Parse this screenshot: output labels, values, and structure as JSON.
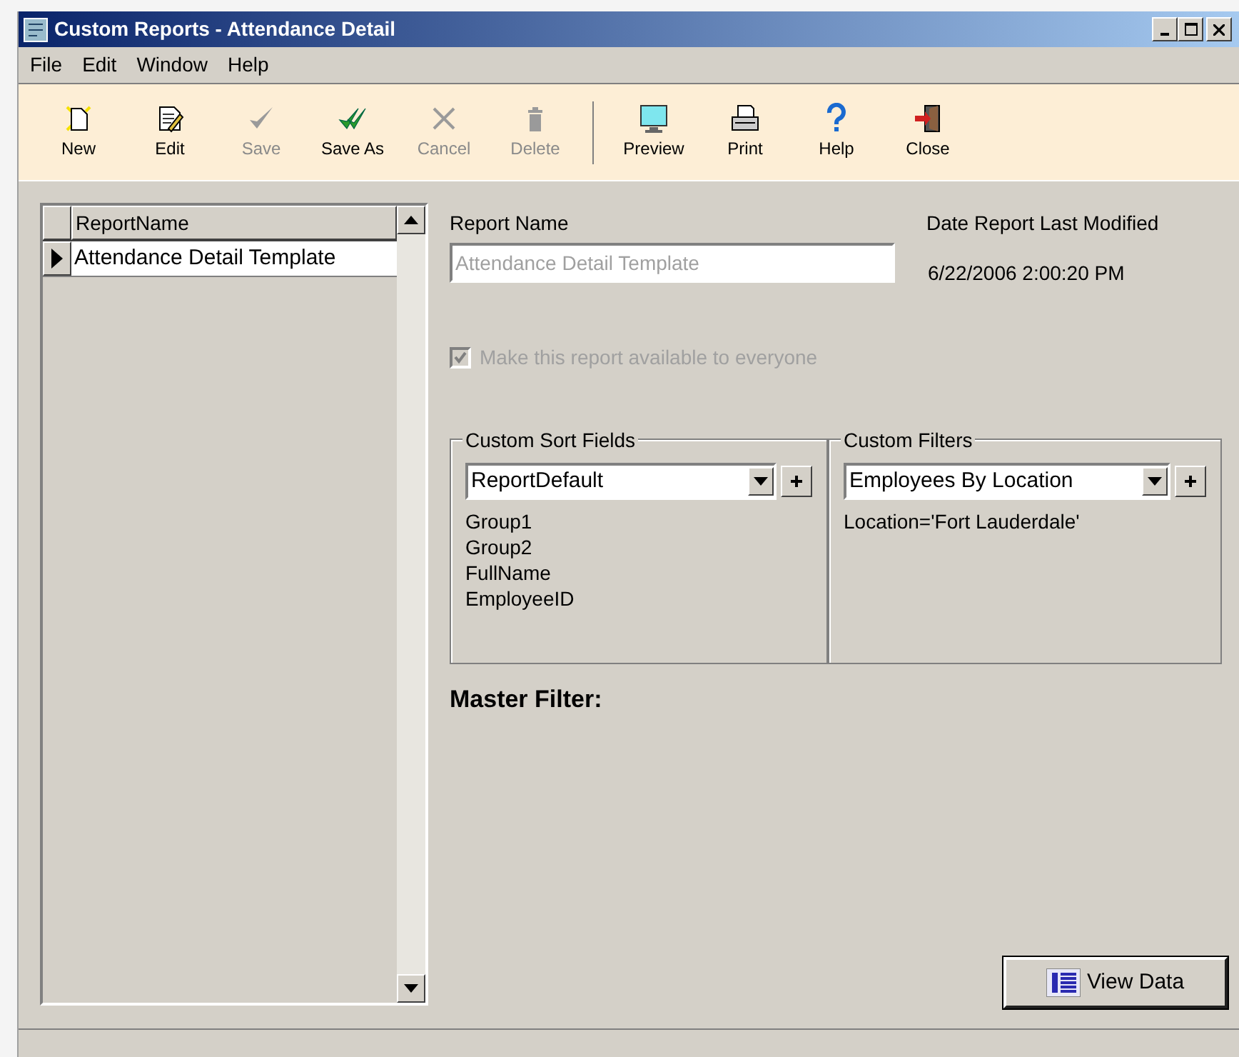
{
  "window": {
    "title": "Custom Reports - Attendance Detail"
  },
  "menu": [
    "File",
    "Edit",
    "Window",
    "Help"
  ],
  "toolbar": {
    "groups": [
      [
        {
          "label": "New",
          "disabled": false
        },
        {
          "label": "Edit",
          "disabled": false
        },
        {
          "label": "Save",
          "disabled": true
        },
        {
          "label": "Save As",
          "disabled": false
        },
        {
          "label": "Cancel",
          "disabled": true
        },
        {
          "label": "Delete",
          "disabled": true
        }
      ],
      [
        {
          "label": "Preview",
          "disabled": false
        },
        {
          "label": "Print",
          "disabled": false
        },
        {
          "label": "Help",
          "disabled": false
        },
        {
          "label": "Close",
          "disabled": false
        }
      ]
    ]
  },
  "report_list": {
    "columns": [
      "ReportName"
    ],
    "rows": [
      {
        "cells": [
          "Attendance Detail Template"
        ],
        "selected": true
      }
    ]
  },
  "report_name": {
    "label": "Report Name",
    "value": "Attendance Detail Template",
    "disabled": true
  },
  "date_modified": {
    "label": "Date Report Last Modified",
    "value": "6/22/2006 2:00:20 PM"
  },
  "share_checkbox": {
    "label": "Make this report available to everyone",
    "checked": true,
    "disabled": true
  },
  "sort_fields": {
    "title": "Custom Sort Fields",
    "value": "ReportDefault",
    "items": [
      "Group1",
      "Group2",
      "FullName",
      "EmployeeID"
    ]
  },
  "filters": {
    "title": "Custom Filters",
    "value": "Employees By Location",
    "items": [
      "Location='Fort Lauderdale'"
    ]
  },
  "master_filter": {
    "label": "Master Filter:"
  },
  "view_data_button": {
    "label": "View Data"
  }
}
